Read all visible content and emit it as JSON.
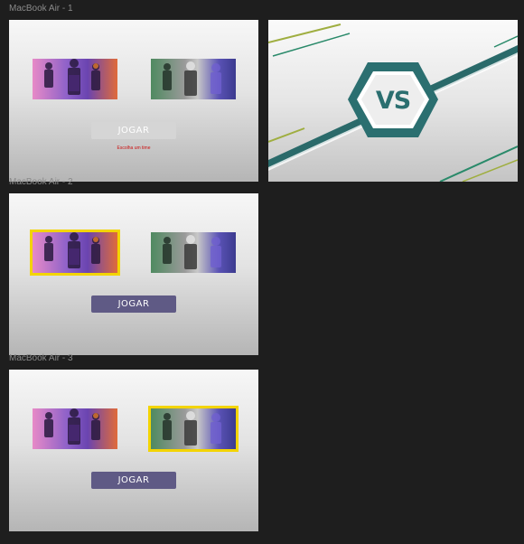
{
  "frames": [
    {
      "label": "MacBook Air - 1",
      "button_label": "JOGAR",
      "hint": "Escolha um time"
    },
    {
      "label": "MacBook Air - 2",
      "button_label": "JOGAR"
    },
    {
      "label": "MacBook Air - 3",
      "button_label": "JOGAR"
    }
  ],
  "vs_screen": {
    "text": "VS"
  },
  "colors": {
    "canvas": "#1e1e1e",
    "selected_border": "#f3d400",
    "button_active": "#5f5a85",
    "button_inactive": "#d5d5d5",
    "hint_text": "#cc1111",
    "vs_teal": "#2b6f70"
  },
  "icons": [
    "ninja-team-left-image",
    "ninja-team-right-image",
    "vs-hexagon-icon"
  ]
}
